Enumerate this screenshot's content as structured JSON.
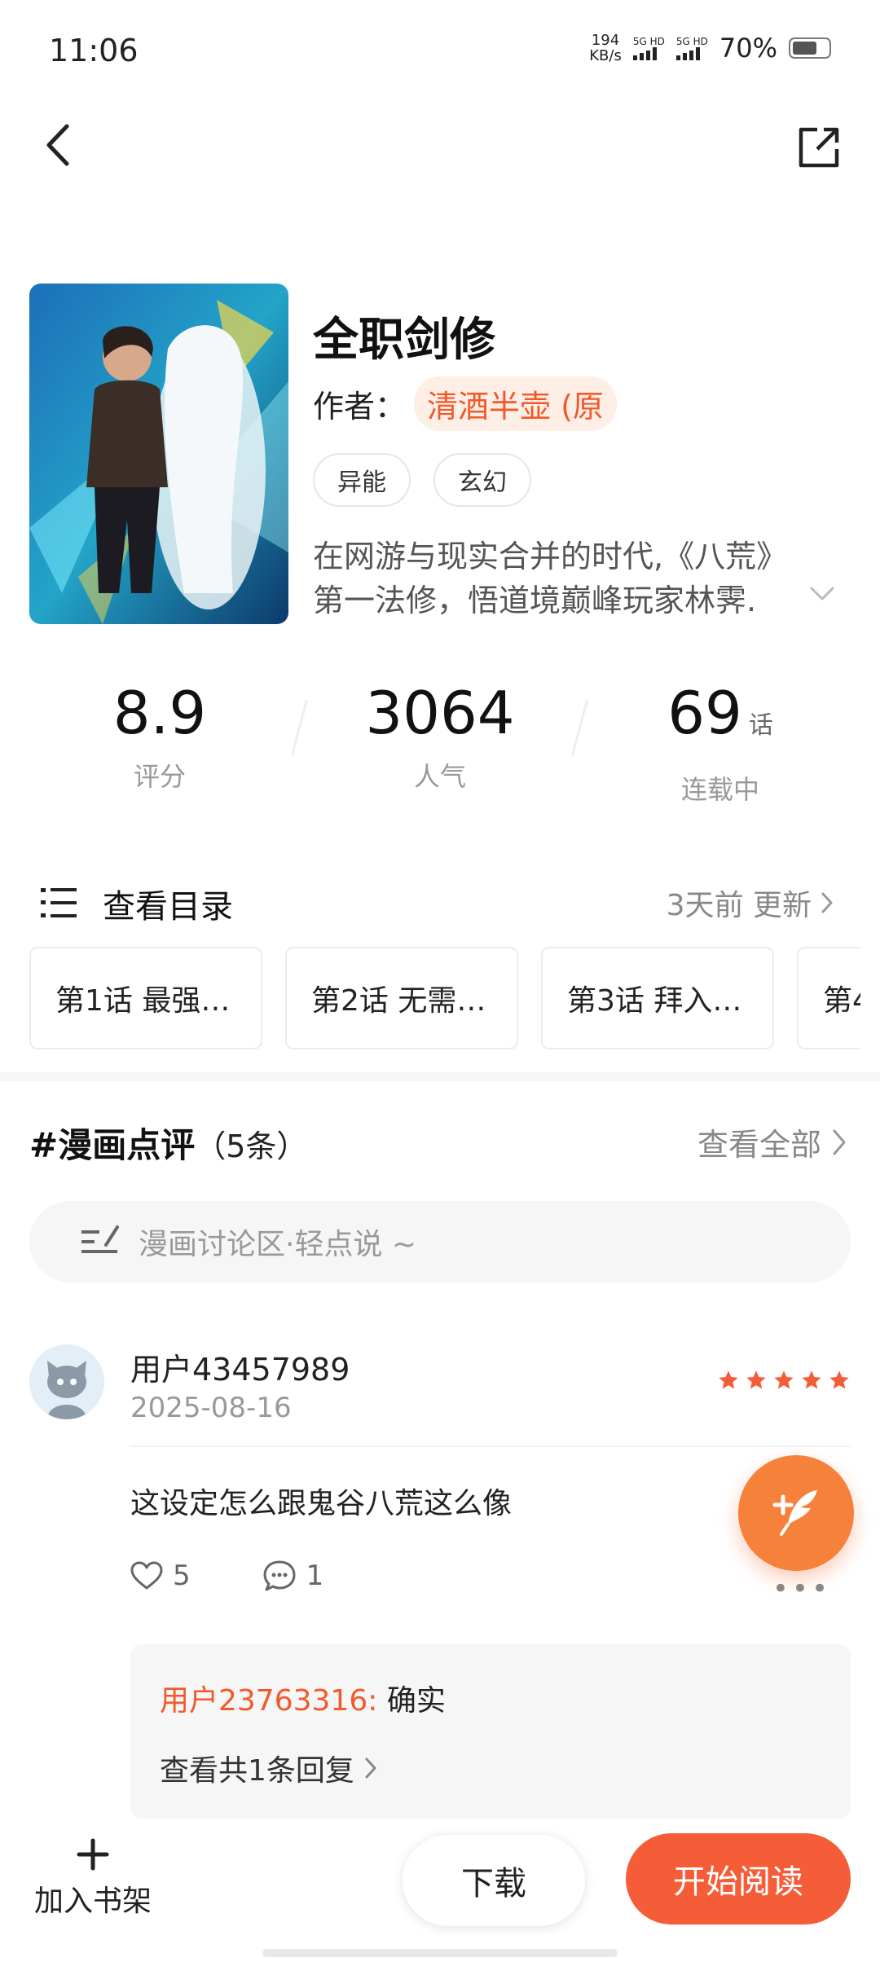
{
  "status_bar": {
    "time": "11:06",
    "net_speed_value": "194",
    "net_speed_unit": "KB/s",
    "sim1_label": "5G HD",
    "sim2_label": "5G HD",
    "battery_percent": "70%",
    "battery_level": 0.7
  },
  "nav": {
    "back_icon": "chevron-left-icon",
    "share_icon": "share-external-icon"
  },
  "book": {
    "title": "全职剑修",
    "author_label": "作者：",
    "author_name": "清酒半壶 (原",
    "tags": [
      "异能",
      "玄幻"
    ],
    "description_line1": "在网游与现实合并的时代,《八荒》",
    "description_line2": "第一法修，悟道境巅峰玩家林霁."
  },
  "stats": {
    "rating_value": "8.9",
    "rating_label": "评分",
    "popularity_value": "3064",
    "popularity_label": "人气",
    "chapters_value": "69",
    "chapters_unit": "话",
    "chapters_label": "连载中"
  },
  "catalog": {
    "title": "查看目录",
    "update_text": "3天前 更新",
    "chapters": [
      "第1话  最强…",
      "第2话  无需…",
      "第3话  拜入…",
      "第4"
    ]
  },
  "reviews": {
    "title": "#漫画点评",
    "count": "（5条）",
    "view_all": "查看全部",
    "input_placeholder": "漫画讨论区·轻点说 ~",
    "comment": {
      "user": "用户43457989",
      "date": "2025-08-16",
      "rating_stars": 5,
      "text": "这设定怎么跟鬼谷八荒这么像",
      "likes": "5",
      "replies": "1",
      "more": "•••",
      "reply_user": "用户23763316:",
      "reply_text": " 确实",
      "reply_more": "查看共1条回复"
    }
  },
  "bottom": {
    "shelf_icon": "plus-icon",
    "shelf_label": "加入书架",
    "download_label": "下载",
    "read_label": "开始阅读"
  },
  "colors": {
    "accent": "#f55d38",
    "author_chip_bg": "#fdeee6",
    "fab": "#f5813a"
  }
}
